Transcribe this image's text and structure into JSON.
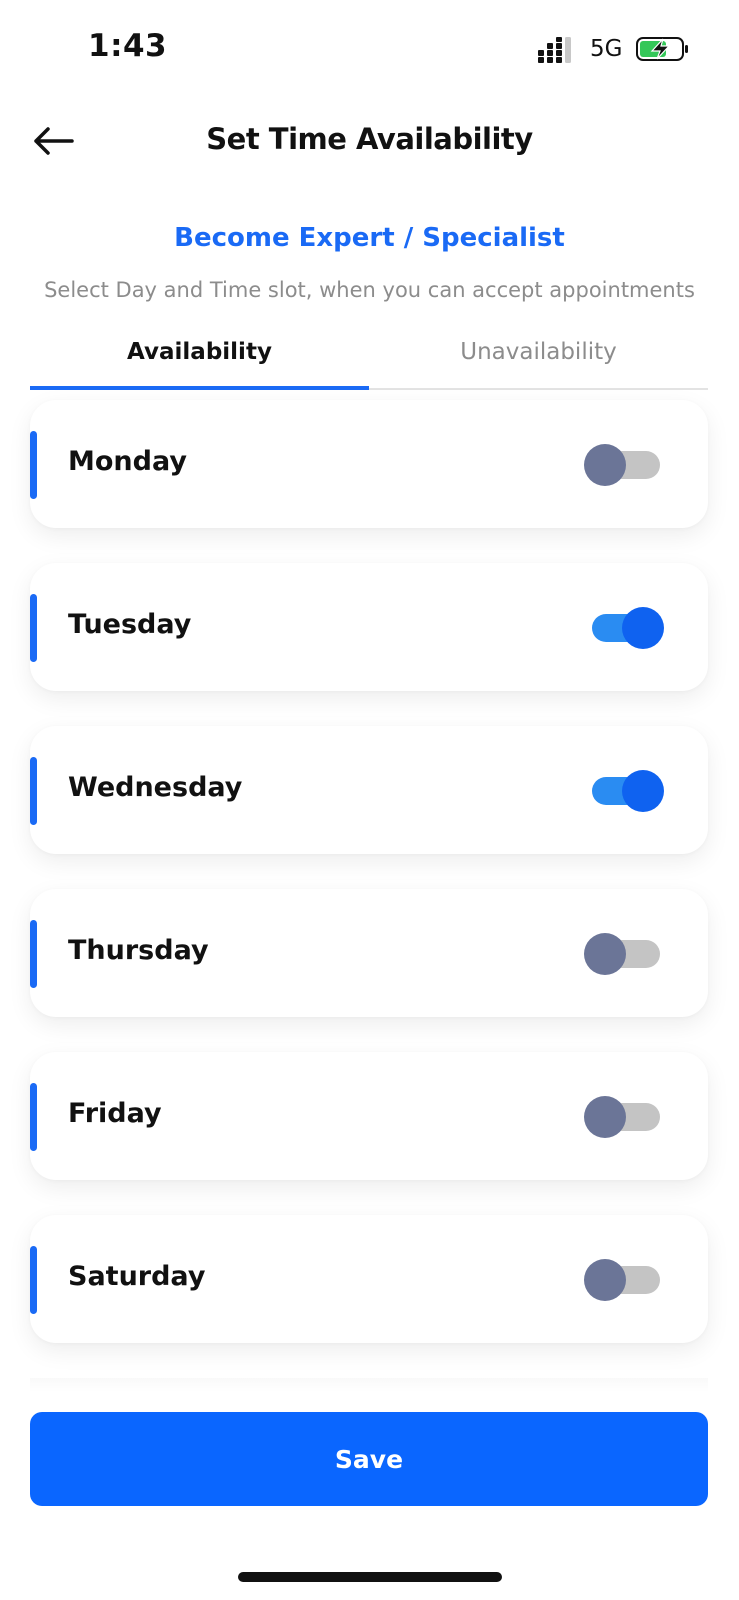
{
  "status_bar": {
    "time": "1:43",
    "network": "5G",
    "signal_icon": "signal-bars-icon",
    "battery_icon": "battery-charging-icon",
    "battery_color": "#34c759"
  },
  "header": {
    "back_icon": "arrow-left-icon",
    "title": "Set Time Availability"
  },
  "intro": {
    "heading": "Become Expert / Specialist",
    "description": "Select Day and Time slot, when you can accept appointments"
  },
  "tabs": [
    {
      "label": "Availability",
      "active": true
    },
    {
      "label": "Unavailability",
      "active": false
    }
  ],
  "days": [
    {
      "label": "Monday",
      "enabled": false
    },
    {
      "label": "Tuesday",
      "enabled": true
    },
    {
      "label": "Wednesday",
      "enabled": true
    },
    {
      "label": "Thursday",
      "enabled": false
    },
    {
      "label": "Friday",
      "enabled": false
    },
    {
      "label": "Saturday",
      "enabled": false
    }
  ],
  "actions": {
    "save_label": "Save"
  },
  "colors": {
    "accent": "#1a6af5",
    "button": "#0a66ff",
    "toggle_on_knob": "#0f62f0",
    "toggle_on_track": "#2a8cf2",
    "toggle_off_knob": "#6b7597",
    "toggle_off_track": "#c4c4c4"
  }
}
